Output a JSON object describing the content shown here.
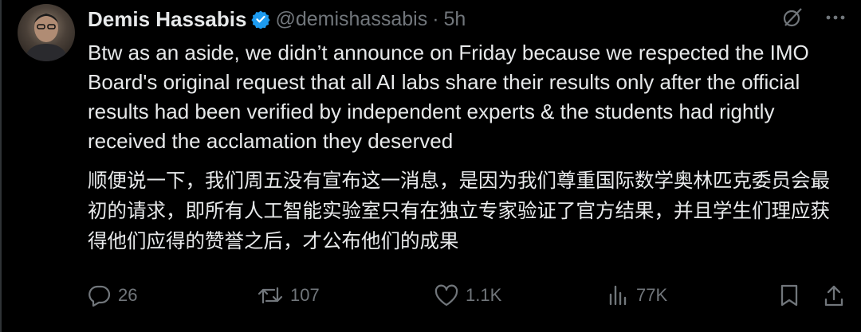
{
  "tweet": {
    "author_name": "Demis Hassabis",
    "handle": "@demishassabis",
    "separator": "·",
    "time": "5h",
    "text_en": "Btw as an aside, we didn’t announce on Friday because we respected the IMO Board's original request that all AI labs share their results only after the official results had been verified by independent experts & the students had rightly received the acclamation they deserved",
    "text_zh": "顺便说一下，我们周五没有宣布这一消息，是因为我们尊重国际数学奥林匹克委员会最初的请求，即所有人工智能实验室只有在独立专家验证了官方结果，并且学生们理应获得他们应得的赞誉之后，才公布他们的成果"
  },
  "actions": {
    "reply_count": "26",
    "repost_count": "107",
    "like_count": "1.1K",
    "view_count": "77K"
  },
  "icons": {
    "verified": "verified-badge-icon",
    "grok": "grok-icon",
    "more": "more-icon",
    "reply": "reply-icon",
    "repost": "repost-icon",
    "like": "like-icon",
    "views": "views-icon",
    "bookmark": "bookmark-icon",
    "share": "share-icon"
  },
  "colors": {
    "background": "#000000",
    "text": "#e7e9ea",
    "muted": "#71767b",
    "verified": "#1d9bf0"
  }
}
